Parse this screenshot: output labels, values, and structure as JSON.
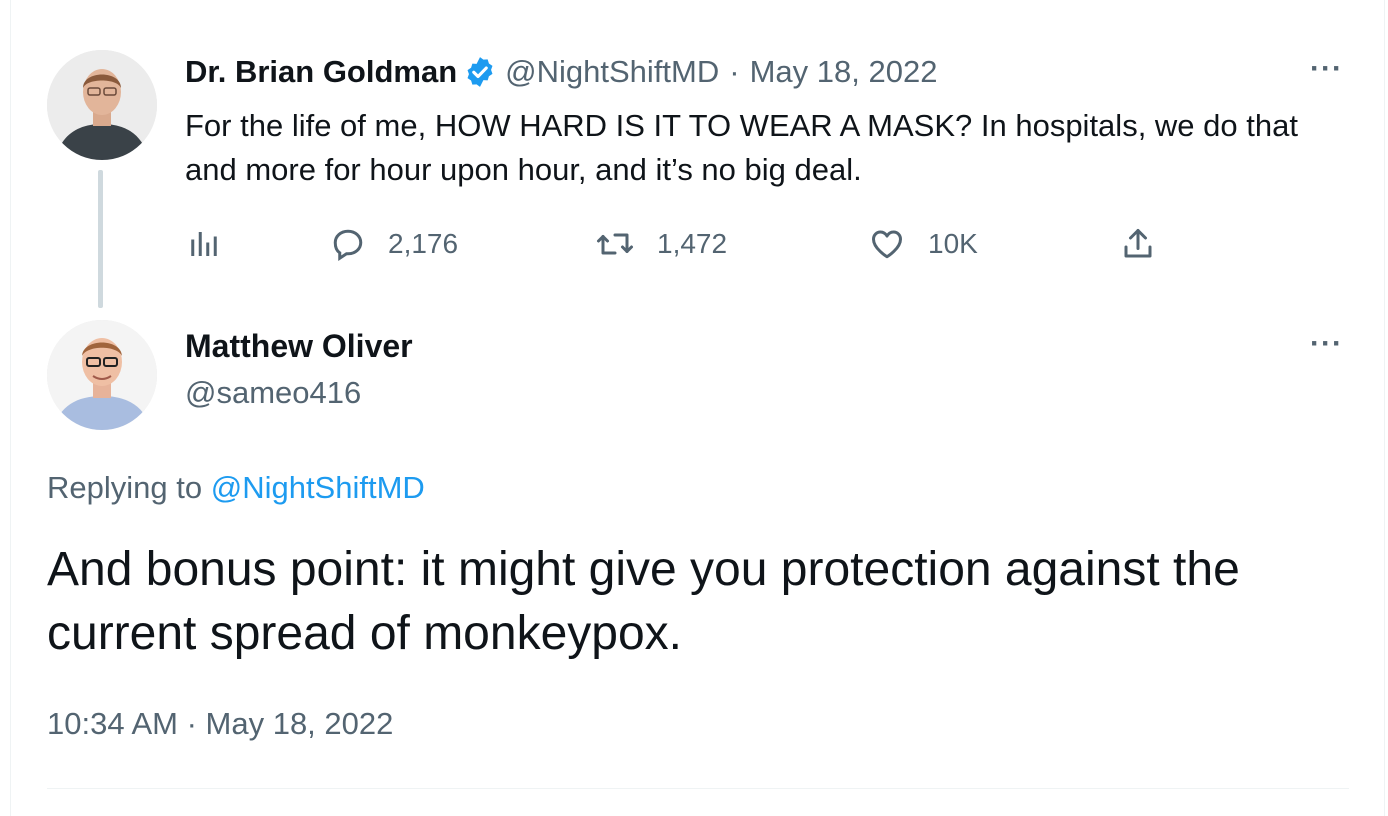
{
  "parent": {
    "name": "Dr. Brian Goldman",
    "handle": "@NightShiftMD",
    "date": "May 18, 2022",
    "separator": "·",
    "text": "For the life of me, HOW HARD IS IT TO WEAR A MASK? In hospitals, we do that and more for hour upon hour, and it’s no big deal.",
    "more_label": "···",
    "actions": {
      "analytics_icon": "analytics-icon",
      "reply_count": "2,176",
      "retweet_count": "1,472",
      "like_count": "10K",
      "share_icon": "share-icon"
    }
  },
  "reply": {
    "name": "Matthew Oliver",
    "handle": "@sameo416",
    "more_label": "···",
    "replying_prefix": "Replying to",
    "replying_to": "@NightShiftMD",
    "text": "And bonus point: it might give you protection against the current spread of monkeypox.",
    "timestamp": "10:34 AM · May 18, 2022"
  },
  "colors": {
    "text_primary": "#0f1419",
    "text_secondary": "#536471",
    "accent": "#1d9bf0",
    "thread_line": "#cfd9de"
  }
}
